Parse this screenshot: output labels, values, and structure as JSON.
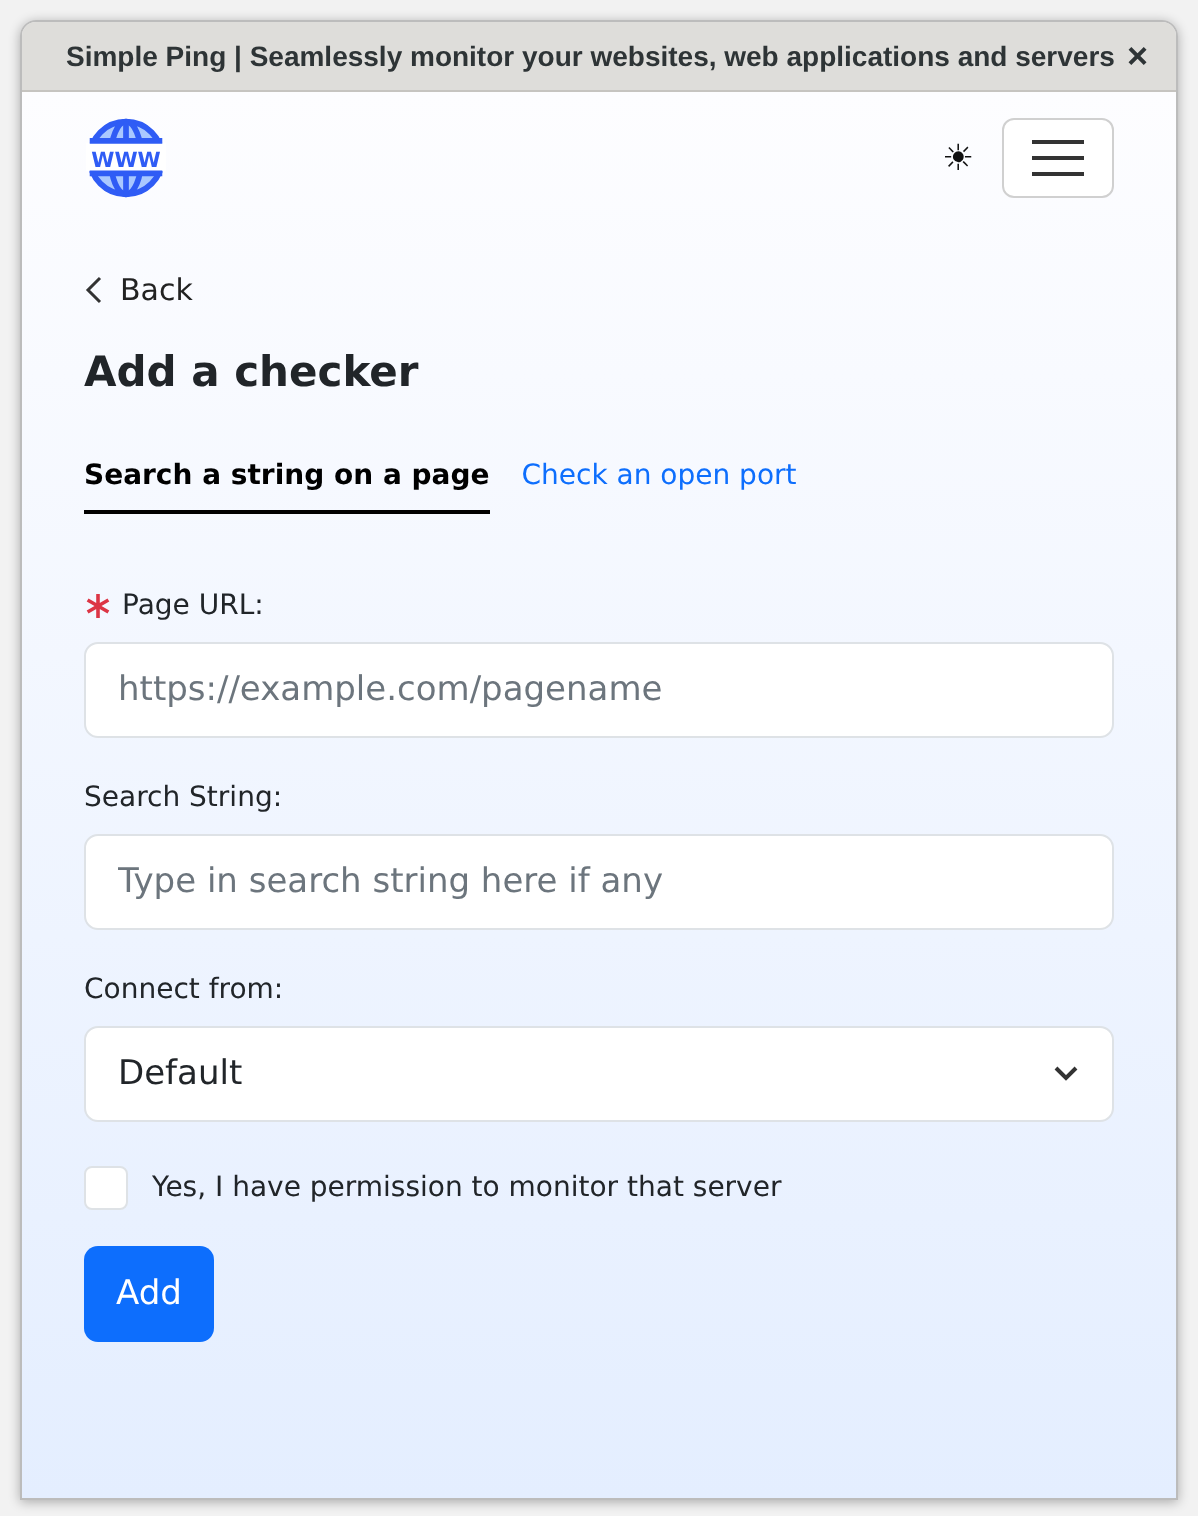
{
  "window": {
    "title": "Simple Ping | Seamlessly monitor your websites, web applications and servers",
    "close": "×"
  },
  "header": {
    "logo_text": "WWW",
    "theme_toggle": "☀"
  },
  "back": "Back",
  "heading": "Add a checker",
  "tabs": [
    {
      "label": "Search a string on a page",
      "selected": true
    },
    {
      "label": "Check an open port",
      "selected": false
    }
  ],
  "fields": [
    {
      "kind": "input",
      "label": "Page URL:",
      "required": true,
      "placeholder": "https://example.com/pagename"
    },
    {
      "kind": "input",
      "label": "Search String:",
      "required": false,
      "placeholder": "Type in search string here if any"
    },
    {
      "kind": "select",
      "label": "Connect from:",
      "required": false,
      "value": "Default"
    }
  ],
  "permission": {
    "label": "Yes, I have permission to monitor that server",
    "checked": false
  },
  "submit": "Add"
}
